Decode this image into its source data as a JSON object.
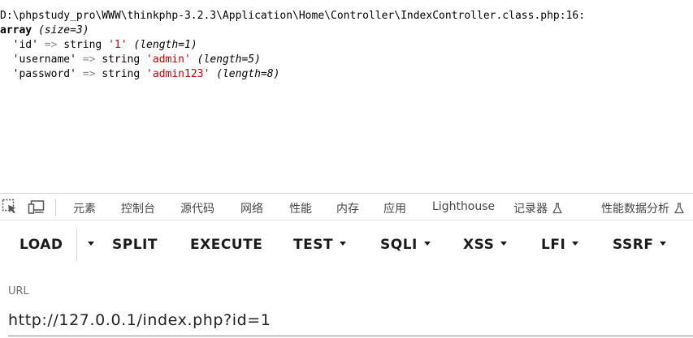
{
  "dump": {
    "path": "D:\\phpstudy_pro\\WWW\\thinkphp-3.2.3\\Application\\Home\\Controller\\IndexController.class.php:16:",
    "array_kw": "array",
    "array_size": "(size=3)",
    "rows": [
      {
        "key": "'id'",
        "arrow": "=>",
        "type": "string",
        "value": "'1'",
        "len": "(length=1)"
      },
      {
        "key": "'username'",
        "arrow": "=>",
        "type": "string",
        "value": "'admin'",
        "len": "(length=5)"
      },
      {
        "key": "'password'",
        "arrow": "=>",
        "type": "string",
        "value": "'admin123'",
        "len": "(length=8)"
      }
    ]
  },
  "devtools": {
    "icons": [
      "inspect-element-icon",
      "device-toolbar-icon"
    ],
    "tabs": [
      "元素",
      "控制台",
      "源代码",
      "网络",
      "性能",
      "内存",
      "应用",
      "Lighthouse",
      "记录器",
      "性能数据分析"
    ]
  },
  "hackbar": {
    "load": "LOAD",
    "split": "SPLIT",
    "execute": "EXECUTE",
    "test": "TEST",
    "sqli": "SQLI",
    "xss": "XSS",
    "lfi": "LFI",
    "ssrf": "SSRF"
  },
  "url": {
    "label": "URL",
    "value": "http://127.0.0.1/index.php?id=1"
  }
}
